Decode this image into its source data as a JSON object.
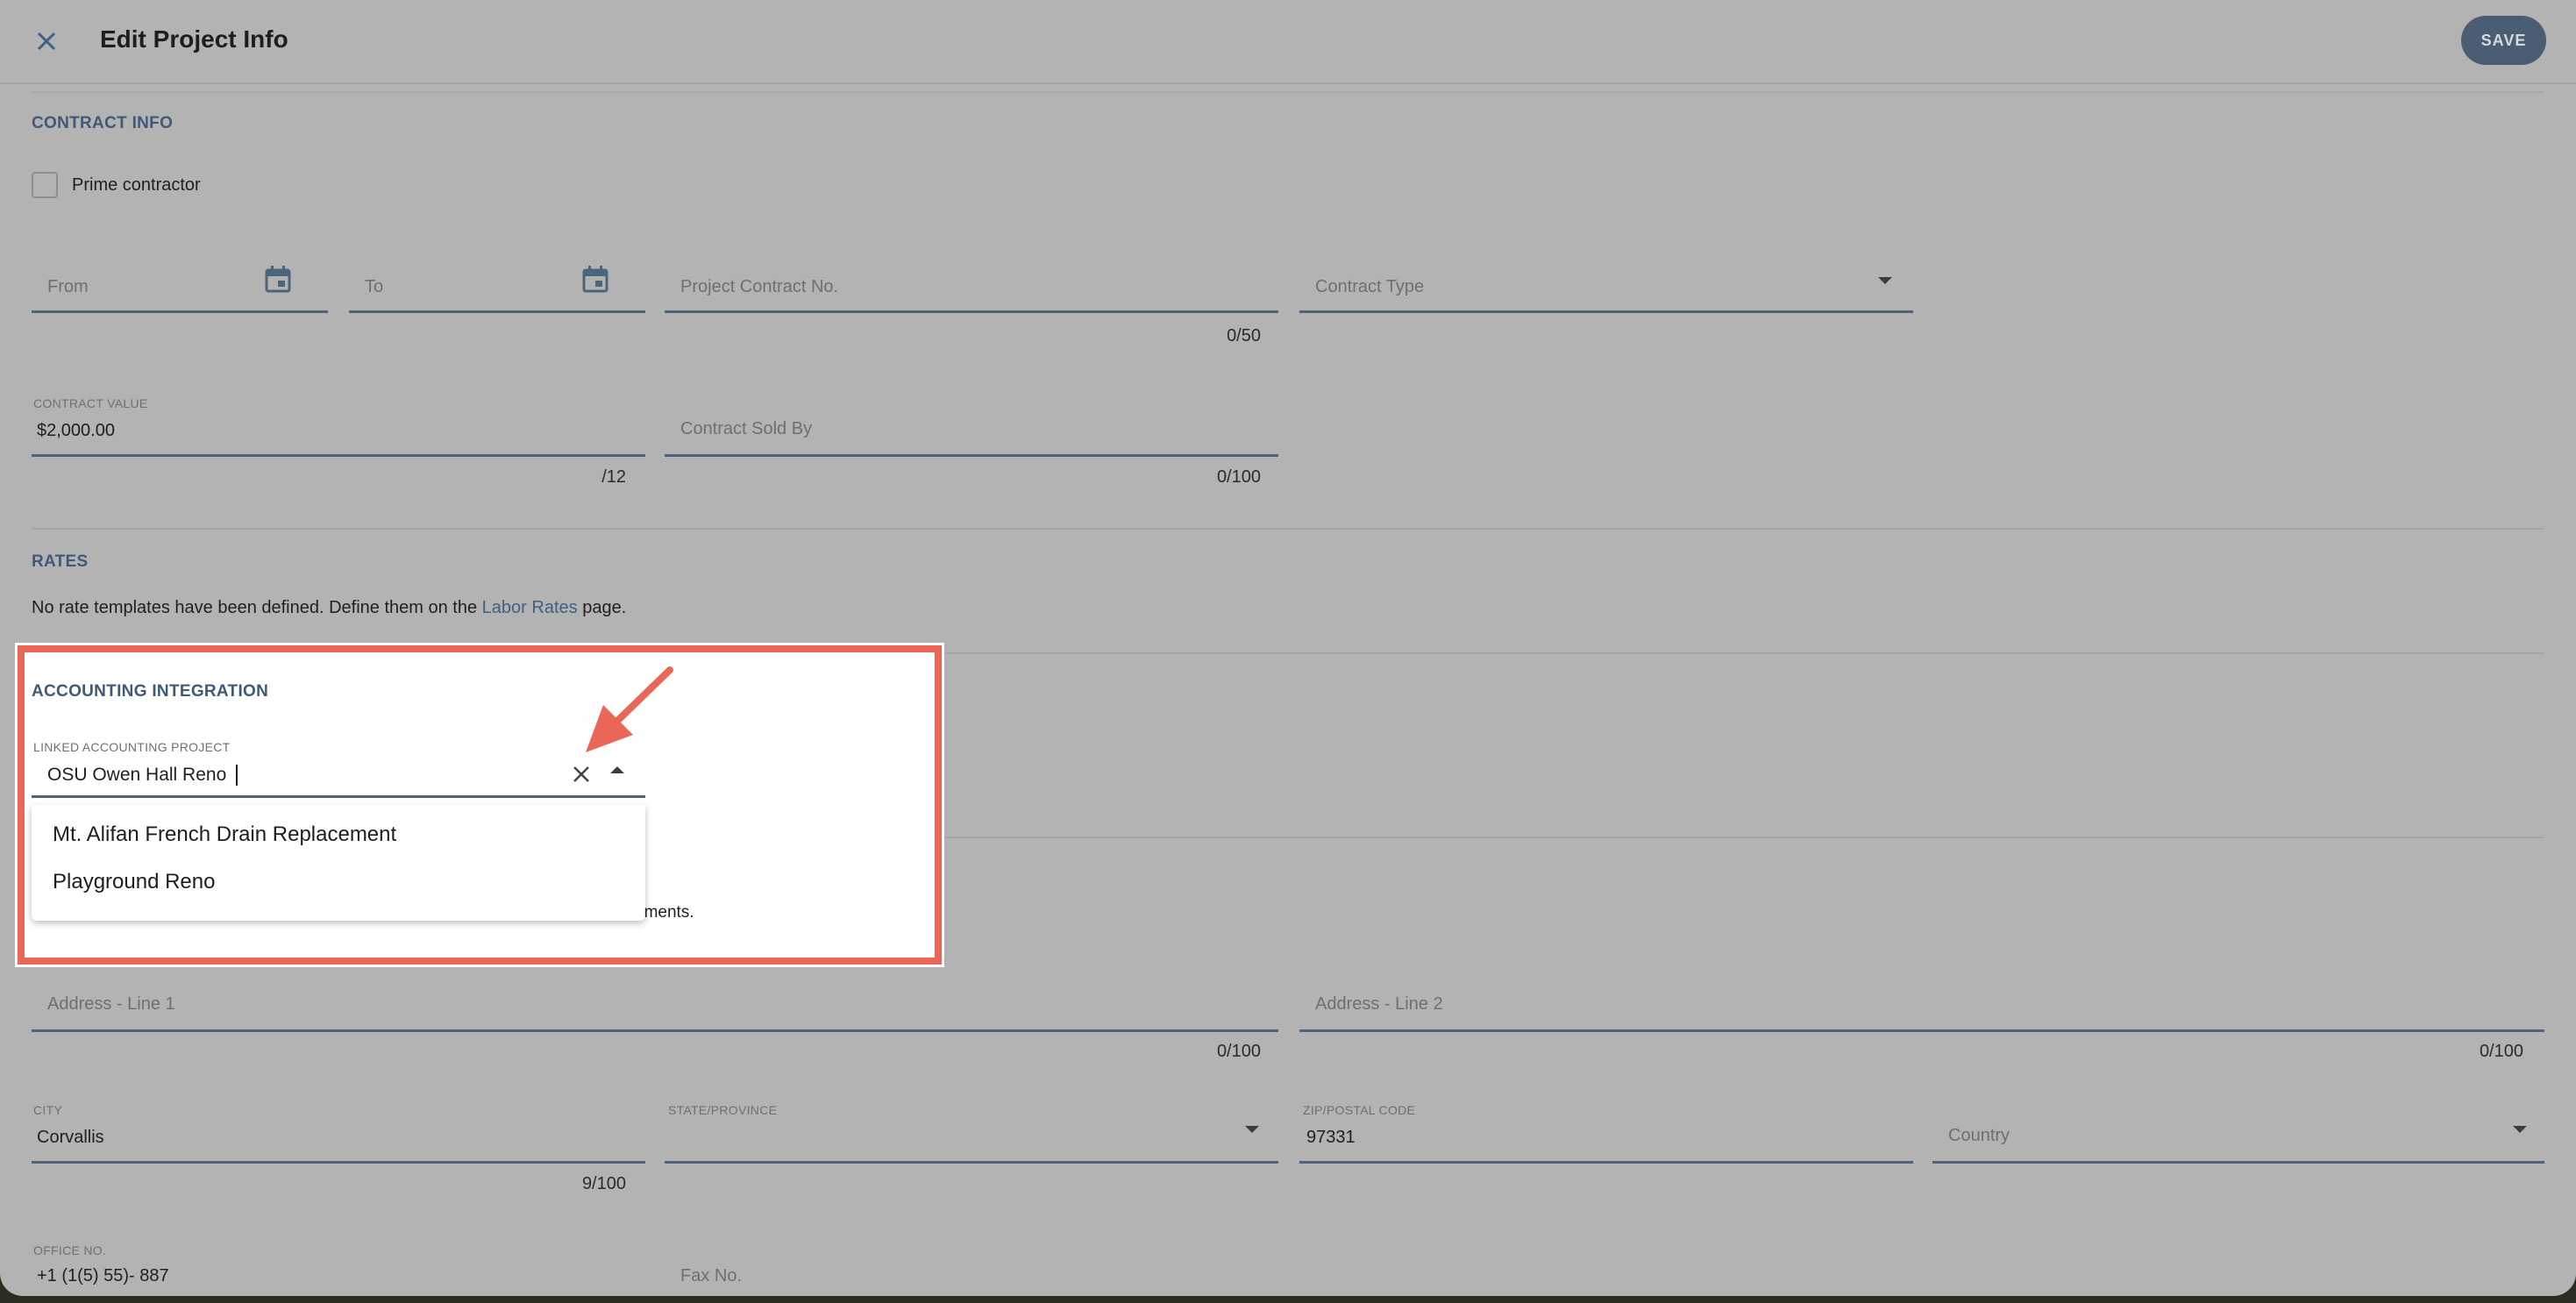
{
  "header": {
    "title": "Edit Project Info",
    "save_label": "SAVE",
    "close_icon": "close-icon"
  },
  "contract_info": {
    "section_title": "CONTRACT INFO",
    "prime_contractor_label": "Prime contractor",
    "prime_contractor_checked": false,
    "from_placeholder": "From",
    "to_placeholder": "To",
    "project_contract_no_placeholder": "Project Contract No.",
    "project_contract_no_counter": "0/50",
    "contract_type_placeholder": "Contract Type",
    "contract_value_label": "CONTRACT VALUE",
    "contract_value": "$2,000.00",
    "contract_value_counter": "/12",
    "contract_sold_by_placeholder": "Contract Sold By",
    "contract_sold_by_counter": "0/100"
  },
  "rates": {
    "section_title": "RATES",
    "text_before": "No rate templates have been defined. Define them on the ",
    "link_text": "Labor Rates",
    "text_after": " page."
  },
  "accounting": {
    "section_title": "ACCOUNTING INTEGRATION",
    "linked_label": "LINKED ACCOUNTING PROJECT",
    "linked_value": "OSU Owen Hall Reno",
    "options": [
      "Mt. Alifan French Drain Replacement",
      "Playground Reno"
    ],
    "partial_text": "uments."
  },
  "address": {
    "line1_placeholder": "Address - Line 1",
    "line1_counter": "0/100",
    "line2_placeholder": "Address - Line 2",
    "line2_counter": "0/100",
    "city_label": "CITY",
    "city_value": "Corvallis",
    "city_counter": "9/100",
    "state_label": "STATE/PROVINCE",
    "zip_label": "ZIP/POSTAL CODE",
    "zip_value": "97331",
    "country_placeholder": "Country",
    "office_label": "OFFICE NO.",
    "office_value": "+1 (1(5) 55)- 887",
    "fax_placeholder": "Fax No."
  },
  "colors": {
    "accent": "#4a5d72",
    "highlight": "#ea6656",
    "section_title": "#3f5a78"
  }
}
